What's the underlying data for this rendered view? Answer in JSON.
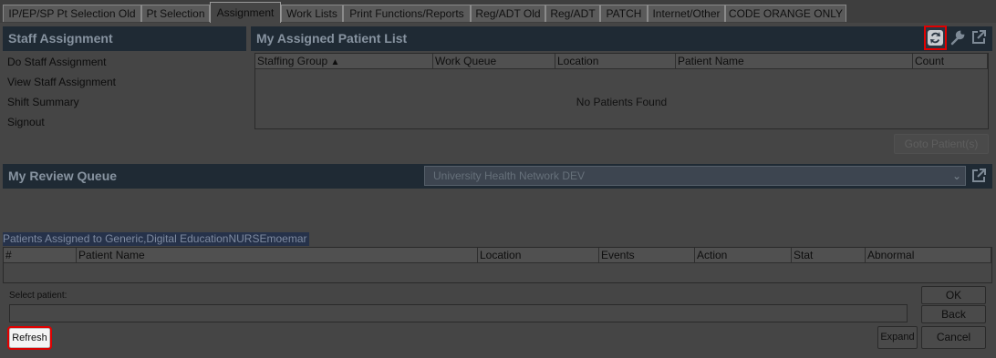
{
  "tabs": [
    {
      "label": "IP/EP/SP Pt Selection Old"
    },
    {
      "label": "Pt Selection"
    },
    {
      "label": "Assignment"
    },
    {
      "label": "Work Lists"
    },
    {
      "label": "Print Functions/Reports"
    },
    {
      "label": "Reg/ADT Old"
    },
    {
      "label": "Reg/ADT"
    },
    {
      "label": "PATCH"
    },
    {
      "label": "Internet/Other"
    },
    {
      "label": "CODE ORANGE ONLY"
    }
  ],
  "staff_assignment": {
    "title": "Staff Assignment",
    "items": [
      {
        "label": "Do Staff Assignment"
      },
      {
        "label": "View Staff Assignment"
      },
      {
        "label": "Shift Summary"
      },
      {
        "label": "Signout"
      }
    ]
  },
  "assigned_list": {
    "title": "My Assigned Patient List",
    "columns": [
      "Staffing Group",
      "Work Queue",
      "Location",
      "Patient Name",
      "Count"
    ],
    "sort_indicator": "▲",
    "empty_message": "No Patients Found",
    "goto_button": "Goto Patient(s)"
  },
  "review_queue": {
    "title": "My Review Queue",
    "org_select": "University Health Network DEV",
    "assigned_label": "Patients Assigned to Generic,Digital EducationNURSEmoemar",
    "columns": [
      "#",
      "Patient Name",
      "Location",
      "Events",
      "Action",
      "Stat",
      "Abnormal"
    ]
  },
  "footer": {
    "select_label": "Select patient:",
    "select_value": "",
    "refresh": "Refresh",
    "ok": "OK",
    "back": "Back",
    "expand": "Expand",
    "cancel": "Cancel"
  },
  "icons": {
    "refresh": "refresh-icon",
    "wrench": "wrench-icon",
    "popout": "popout-icon",
    "dropdown": "chevron-down-icon"
  }
}
